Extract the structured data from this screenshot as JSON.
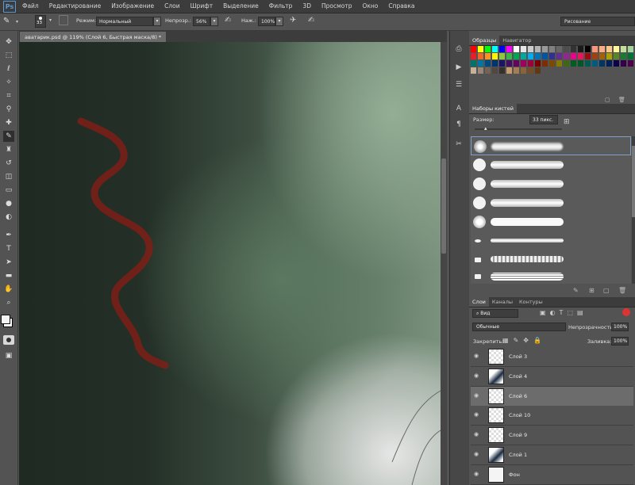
{
  "menubar": {
    "logo": "Ps",
    "items": [
      "Файл",
      "Редактирование",
      "Изображение",
      "Слои",
      "Шрифт",
      "Выделение",
      "Фильтр",
      "3D",
      "Просмотр",
      "Окно",
      "Справка"
    ]
  },
  "options": {
    "brush_size": "33",
    "mode_label": "Режим:",
    "mode_value": "Нормальный",
    "opacity_label": "Непрозр.:",
    "opacity_value": "56%",
    "flow_label": "Наж.:",
    "flow_value": "100%",
    "workspace": "Рисование"
  },
  "document": {
    "tab_title": "аватарик.psd @ 119% (Слой 6, Быстрая маска/8) *",
    "close_glyph": "×"
  },
  "swatches_panel": {
    "tabs": [
      "Образцы",
      "Навигатор"
    ],
    "colors": [
      "#ff0000",
      "#ffff00",
      "#00ff00",
      "#00ffff",
      "#0000ff",
      "#ff00ff",
      "#ffffff",
      "#e6e6e6",
      "#cccccc",
      "#b3b3b3",
      "#999999",
      "#808080",
      "#666666",
      "#4d4d4d",
      "#333333",
      "#1a1a1a",
      "#000000",
      "#f7977a",
      "#f9ad81",
      "#fdc68a",
      "#fff79a",
      "#c4df9b",
      "#a2d39c",
      "#ed1c24",
      "#f26522",
      "#f7941d",
      "#fff200",
      "#8dc63f",
      "#39b54a",
      "#00a651",
      "#00a99d",
      "#00aeef",
      "#0072bc",
      "#0054a6",
      "#2e3192",
      "#662d91",
      "#92278f",
      "#ec008c",
      "#ed145b",
      "#9e0b0f",
      "#a0410d",
      "#a3620a",
      "#aba000",
      "#598527",
      "#1a7b30",
      "#007236",
      "#00746b",
      "#0076a3",
      "#004b80",
      "#003471",
      "#1b1464",
      "#440e62",
      "#630460",
      "#9e005d",
      "#9e0039",
      "#790000",
      "#7b2e00",
      "#7d4900",
      "#827b00",
      "#406618",
      "#005e20",
      "#005826",
      "#005952",
      "#005b7f",
      "#003663",
      "#002157",
      "#0d004c",
      "#32004b",
      "#4b0049",
      "#c7b299",
      "#998675",
      "#736357",
      "#534741",
      "#37302d",
      "#c69c6d",
      "#a67c52",
      "#8c6239",
      "#754c24",
      "#603913"
    ]
  },
  "brushes_panel": {
    "tab": "Наборы кистей",
    "size_label": "Размер:",
    "size_value": "33 пикс."
  },
  "layers_panel": {
    "tabs": [
      "Слои",
      "Каналы",
      "Контуры"
    ],
    "filter_label": "Вид",
    "blend_mode": "Обычные",
    "opacity_label": "Непрозрачность:",
    "opacity_value": "100%",
    "lock_label": "Закрепить:",
    "fill_label": "Заливка:",
    "fill_value": "100%",
    "layers": [
      {
        "name": "Слой 3"
      },
      {
        "name": "Слой 4"
      },
      {
        "name": "Слой 6"
      },
      {
        "name": "Слой 10"
      },
      {
        "name": "Слой 9"
      },
      {
        "name": "Слой 1"
      },
      {
        "name": "Фон"
      }
    ],
    "selected_index": 2
  },
  "icons": {
    "eye": "visibility-eye-icon"
  }
}
